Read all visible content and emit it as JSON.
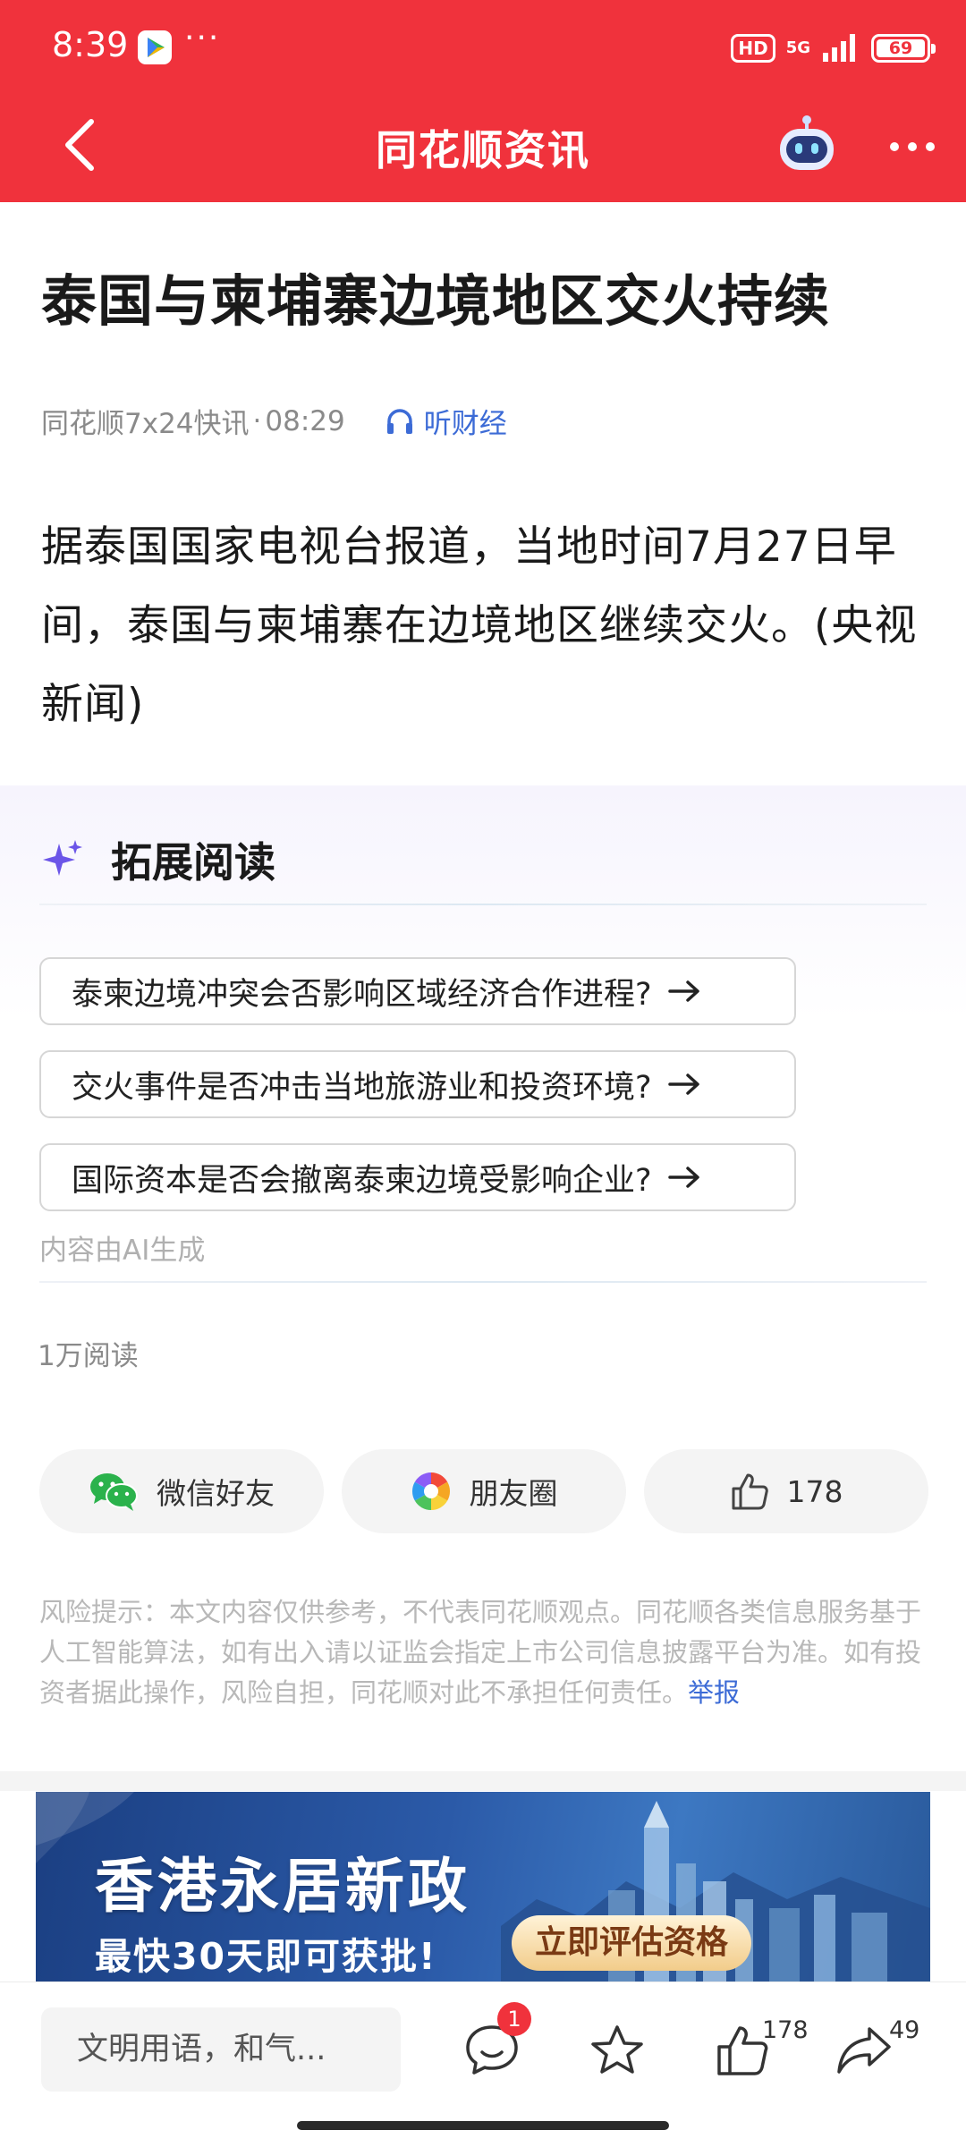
{
  "status_bar": {
    "time": "8:39",
    "dots": "···",
    "hd": "HD",
    "network": "5G",
    "battery": "69"
  },
  "title_bar": {
    "title": "同花顺资讯",
    "back_icon": "chevron-left-icon",
    "robot_icon": "robot-assistant-icon",
    "more_icon": "more-horizontal-icon"
  },
  "article": {
    "headline": "泰国与柬埔寨边境地区交火持续",
    "source": "同花顺7x24快讯",
    "separator": "·",
    "time": "08:29",
    "listen_label": "听财经",
    "body": "据泰国国家电视台报道，当地时间7月27日早间，泰国与柬埔寨在边境地区继续交火。(央视新闻)"
  },
  "extended_reading": {
    "title": "拓展阅读",
    "questions": [
      "泰柬边境冲突会否影响区域经济合作进程?",
      "交火事件是否冲击当地旅游业和投资环境?",
      "国际资本是否会撤离泰柬边境受影响企业?"
    ],
    "ai_note": "内容由AI生成"
  },
  "read_count": "1万阅读",
  "share": {
    "wechat": "微信好友",
    "moments": "朋友圈",
    "like_count": "178"
  },
  "risk_notice": {
    "text": "风险提示：本文内容仅供参考，不代表同花顺观点。同花顺各类信息服务基于人工智能算法，如有出入请以证监会指定上市公司信息披露平台为准。如有投资者据此操作，风险自担，同花顺对此不承担任何责任。",
    "report_link": "举报"
  },
  "ad": {
    "title": "香港永居新政",
    "subtitle": "最快30天即可获批!",
    "cta": "立即评估资格"
  },
  "bottom_bar": {
    "comment_placeholder": "文明用语，和气...",
    "comment_badge": "1",
    "like_count": "178",
    "share_count": "49"
  },
  "colors": {
    "brand_red": "#f0323c",
    "link_blue": "#3c6bd6",
    "accent_purple": "#6b55e8"
  }
}
